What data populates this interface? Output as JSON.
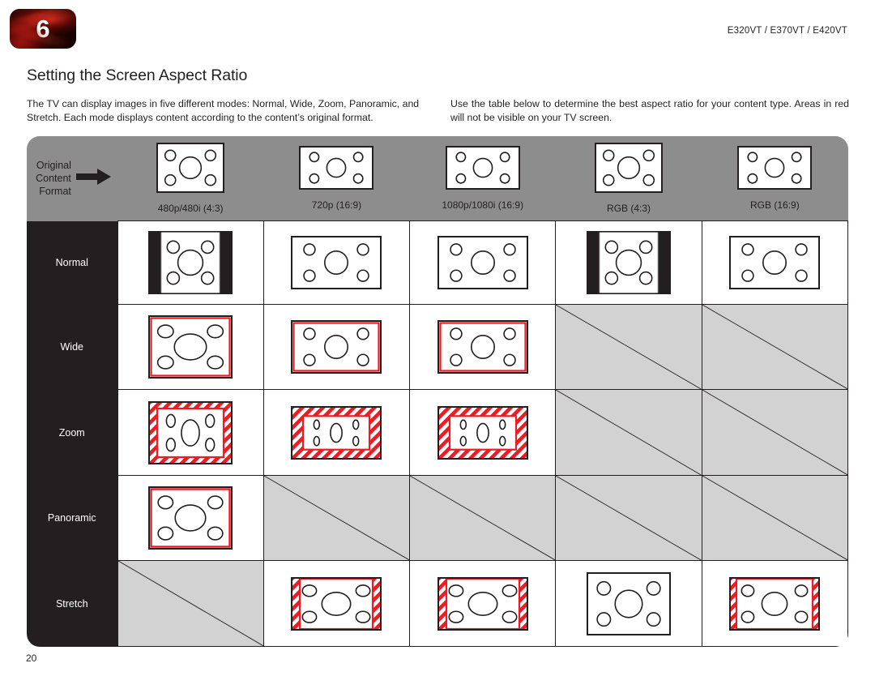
{
  "header": {
    "chapter_badge": "6",
    "models": "E320VT / E370VT / E420VT",
    "section_title": "Setting the Screen Aspect Ratio"
  },
  "intro": {
    "left": "The TV can display images in five different modes: Normal, Wide, Zoom, Panoramic, and Stretch. Each mode displays content according to the content’s original format.",
    "right_line1": "Use the table below to determine the best aspect ratio for your content type.",
    "right_line2": "Areas in red will not be visible on your TV screen."
  },
  "table": {
    "corner_label_lines": [
      "Original",
      "Content",
      "Format"
    ],
    "corner_arrow_icon": "right-arrow-icon",
    "columns": [
      {
        "id": "480",
        "caption": "480p/480i (4:3)",
        "ratio": "4:3"
      },
      {
        "id": "720",
        "caption": "720p (16:9)",
        "ratio": "16:9"
      },
      {
        "id": "1080",
        "caption": "1080p/1080i (16:9)",
        "ratio": "16:9"
      },
      {
        "id": "rgb43",
        "caption": "RGB (4:3)",
        "ratio": "4:3"
      },
      {
        "id": "rgb169",
        "caption": "RGB (16:9)",
        "ratio": "16:9"
      }
    ],
    "rows": [
      {
        "mode": "Normal",
        "cells": [
          {
            "state": "shown",
            "figure": "pillarbox",
            "stretch_x": 1.0,
            "stretch_y": 1.0
          },
          {
            "state": "shown",
            "figure": "plain",
            "stretch_x": 1.0,
            "stretch_y": 1.0
          },
          {
            "state": "shown",
            "figure": "plain",
            "stretch_x": 1.0,
            "stretch_y": 1.0
          },
          {
            "state": "shown",
            "figure": "pillarbox",
            "stretch_x": 1.0,
            "stretch_y": 1.0
          },
          {
            "state": "shown",
            "figure": "plain",
            "stretch_x": 1.0,
            "stretch_y": 1.0
          }
        ]
      },
      {
        "mode": "Wide",
        "cells": [
          {
            "state": "shown",
            "figure": "crop-outline",
            "stretch_x": 1.18,
            "stretch_y": 0.95
          },
          {
            "state": "shown",
            "figure": "crop-outline",
            "stretch_x": 1.0,
            "stretch_y": 1.0
          },
          {
            "state": "shown",
            "figure": "crop-outline",
            "stretch_x": 1.0,
            "stretch_y": 1.0
          },
          {
            "state": "unavailable",
            "figure": "none"
          },
          {
            "state": "unavailable",
            "figure": "none"
          }
        ]
      },
      {
        "mode": "Zoom",
        "cells": [
          {
            "state": "shown",
            "figure": "crop-hatch",
            "stretch_x": 0.86,
            "stretch_y": 1.25
          },
          {
            "state": "shown",
            "figure": "crop-hatch-wide",
            "stretch_x": 0.8,
            "stretch_y": 1.3
          },
          {
            "state": "shown",
            "figure": "crop-hatch-wide",
            "stretch_x": 0.8,
            "stretch_y": 1.3
          },
          {
            "state": "unavailable",
            "figure": "none"
          },
          {
            "state": "unavailable",
            "figure": "none"
          }
        ]
      },
      {
        "mode": "Panoramic",
        "cells": [
          {
            "state": "shown",
            "figure": "crop-topbottom",
            "stretch_x": 1.12,
            "stretch_y": 0.95
          },
          {
            "state": "unavailable",
            "figure": "none"
          },
          {
            "state": "unavailable",
            "figure": "none"
          },
          {
            "state": "unavailable",
            "figure": "none"
          },
          {
            "state": "unavailable",
            "figure": "none"
          }
        ]
      },
      {
        "mode": "Stretch",
        "cells": [
          {
            "state": "unavailable",
            "figure": "none"
          },
          {
            "state": "shown",
            "figure": "crop-sides",
            "stretch_x": 1.25,
            "stretch_y": 1.0
          },
          {
            "state": "shown",
            "figure": "crop-sides",
            "stretch_x": 1.25,
            "stretch_y": 1.0
          },
          {
            "state": "shown",
            "figure": "plain",
            "stretch_x": 1.0,
            "stretch_y": 1.0
          },
          {
            "state": "shown",
            "figure": "crop-sides-narrow",
            "stretch_x": 1.1,
            "stretch_y": 1.0
          }
        ]
      }
    ]
  },
  "colors": {
    "header_bg": "#8d8d8d",
    "mode_col_bg": "#231f20",
    "unavailable_bg": "#d2d2d2",
    "crop_red": "#ed1c24",
    "ink": "#231f20"
  },
  "footer": {
    "page_number": "20"
  }
}
